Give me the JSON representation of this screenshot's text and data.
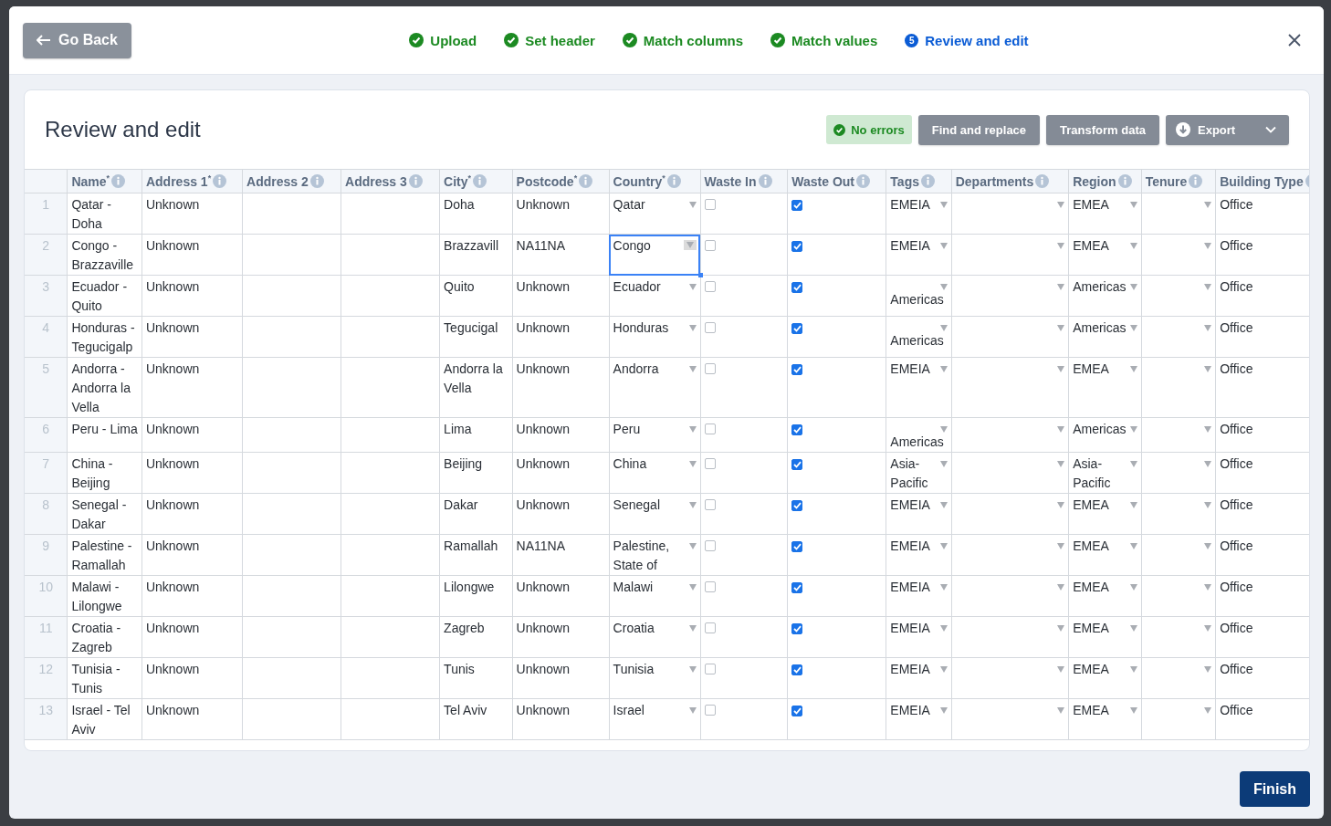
{
  "header": {
    "back_button": "Go Back",
    "steps": [
      {
        "label": "Upload",
        "done": true,
        "selected": false
      },
      {
        "label": "Set header",
        "done": true,
        "selected": false
      },
      {
        "label": "Match columns",
        "done": true,
        "selected": false
      },
      {
        "label": "Match values",
        "done": true,
        "selected": false
      },
      {
        "label": "Review and edit",
        "done": false,
        "selected": true,
        "badge": "5"
      }
    ]
  },
  "card": {
    "title": "Review and edit",
    "status": "No errors",
    "actions": [
      "Find and replace",
      "Transform data"
    ],
    "export": "Export"
  },
  "table": {
    "columns": [
      {
        "label": "Name",
        "mark": "*",
        "kind": "text"
      },
      {
        "label": "Address 1",
        "mark": "*",
        "kind": "text"
      },
      {
        "label": "Address 2",
        "kind": "text"
      },
      {
        "label": "Address 3",
        "kind": "text"
      },
      {
        "label": "City",
        "mark": "*",
        "kind": "text"
      },
      {
        "label": "Postcode",
        "mark": "*",
        "kind": "text"
      },
      {
        "label": "Country",
        "mark": "*",
        "kind": "dropdown"
      },
      {
        "label": "Waste In",
        "kind": "checkbox"
      },
      {
        "label": "Waste Out",
        "kind": "checkbox"
      },
      {
        "label": "Tags",
        "kind": "dropdown"
      },
      {
        "label": "Departments",
        "kind": "dropdown"
      },
      {
        "label": "Region",
        "kind": "dropdown"
      },
      {
        "label": "Tenure",
        "kind": "dropdown"
      },
      {
        "label": "Building Type",
        "kind": "text"
      }
    ],
    "rows": [
      {
        "label": "1",
        "selected": false,
        "cells": [
          "Qatar - Doha",
          "Unknown",
          null,
          null,
          "Doha",
          "Unknown",
          "Qatar",
          false,
          true,
          "EMEIA",
          null,
          "EMEA",
          null,
          "Office"
        ]
      },
      {
        "label": "2",
        "selected": true,
        "cells": [
          "Congo - Brazzaville",
          "Unknown",
          null,
          null,
          "Brazzavill",
          "NA11NA",
          "Congo",
          false,
          true,
          "EMEIA",
          null,
          "EMEA",
          null,
          "Office"
        ]
      },
      {
        "label": "3",
        "selected": false,
        "cells": [
          "Ecuador - Quito",
          "Unknown",
          null,
          null,
          "Quito",
          "Unknown",
          "Ecuador",
          false,
          true,
          "Americas",
          null,
          "Americas",
          null,
          "Office"
        ]
      },
      {
        "label": "4",
        "selected": false,
        "cells": [
          "Honduras - Tegucigalp",
          "Unknown",
          null,
          null,
          "Tegucigal",
          "Unknown",
          "Honduras",
          false,
          true,
          "Americas",
          null,
          "Americas",
          null,
          "Office"
        ]
      },
      {
        "label": "5",
        "selected": false,
        "cells": [
          "Andorra - Andorra la Vella",
          "Unknown",
          null,
          null,
          "Andorra la Vella",
          "Unknown",
          "Andorra",
          false,
          true,
          "EMEIA",
          null,
          "EMEA",
          null,
          "Office"
        ]
      },
      {
        "label": "6",
        "selected": false,
        "cells": [
          "Peru - Lima",
          "Unknown",
          null,
          null,
          "Lima",
          "Unknown",
          "Peru",
          false,
          true,
          "Americas",
          null,
          "Americas",
          null,
          "Office"
        ]
      },
      {
        "label": "7",
        "selected": false,
        "cells": [
          "China - Beijing",
          "Unknown",
          null,
          null,
          "Beijing",
          "Unknown",
          "China",
          false,
          true,
          "Asia-Pacific",
          null,
          "Asia-Pacific",
          null,
          "Office"
        ]
      },
      {
        "label": "8",
        "selected": false,
        "cells": [
          "Senegal - Dakar",
          "Unknown",
          null,
          null,
          "Dakar",
          "Unknown",
          "Senegal",
          false,
          true,
          "EMEIA",
          null,
          "EMEA",
          null,
          "Office"
        ]
      },
      {
        "label": "9",
        "selected": false,
        "cells": [
          "Palestine - Ramallah",
          "Unknown",
          null,
          null,
          "Ramallah",
          "NA11NA",
          "Palestine, State of",
          false,
          true,
          "EMEIA",
          null,
          "EMEA",
          null,
          "Office"
        ]
      },
      {
        "label": "10",
        "selected": false,
        "cells": [
          "Malawi - Lilongwe",
          "Unknown",
          null,
          null,
          "Lilongwe",
          "Unknown",
          "Malawi",
          false,
          true,
          "EMEIA",
          null,
          "EMEA",
          null,
          "Office"
        ]
      },
      {
        "label": "11",
        "selected": false,
        "cells": [
          "Croatia - Zagreb",
          "Unknown",
          null,
          null,
          "Zagreb",
          "Unknown",
          "Croatia",
          false,
          true,
          "EMEIA",
          null,
          "EMEA",
          null,
          "Office"
        ]
      },
      {
        "label": "12",
        "selected": false,
        "cells": [
          "Tunisia - Tunis",
          "Unknown",
          null,
          null,
          "Tunis",
          "Unknown",
          "Tunisia",
          false,
          true,
          "EMEIA",
          null,
          "EMEA",
          null,
          "Office"
        ]
      },
      {
        "label": "13",
        "selected": false,
        "cells": [
          "Israel - Tel Aviv",
          "Unknown",
          null,
          null,
          "Tel Aviv",
          "Unknown",
          "Israel",
          false,
          true,
          "EMEIA",
          null,
          "EMEA",
          null,
          "Office"
        ]
      }
    ]
  },
  "footer": {
    "finish_button": "Finish"
  }
}
